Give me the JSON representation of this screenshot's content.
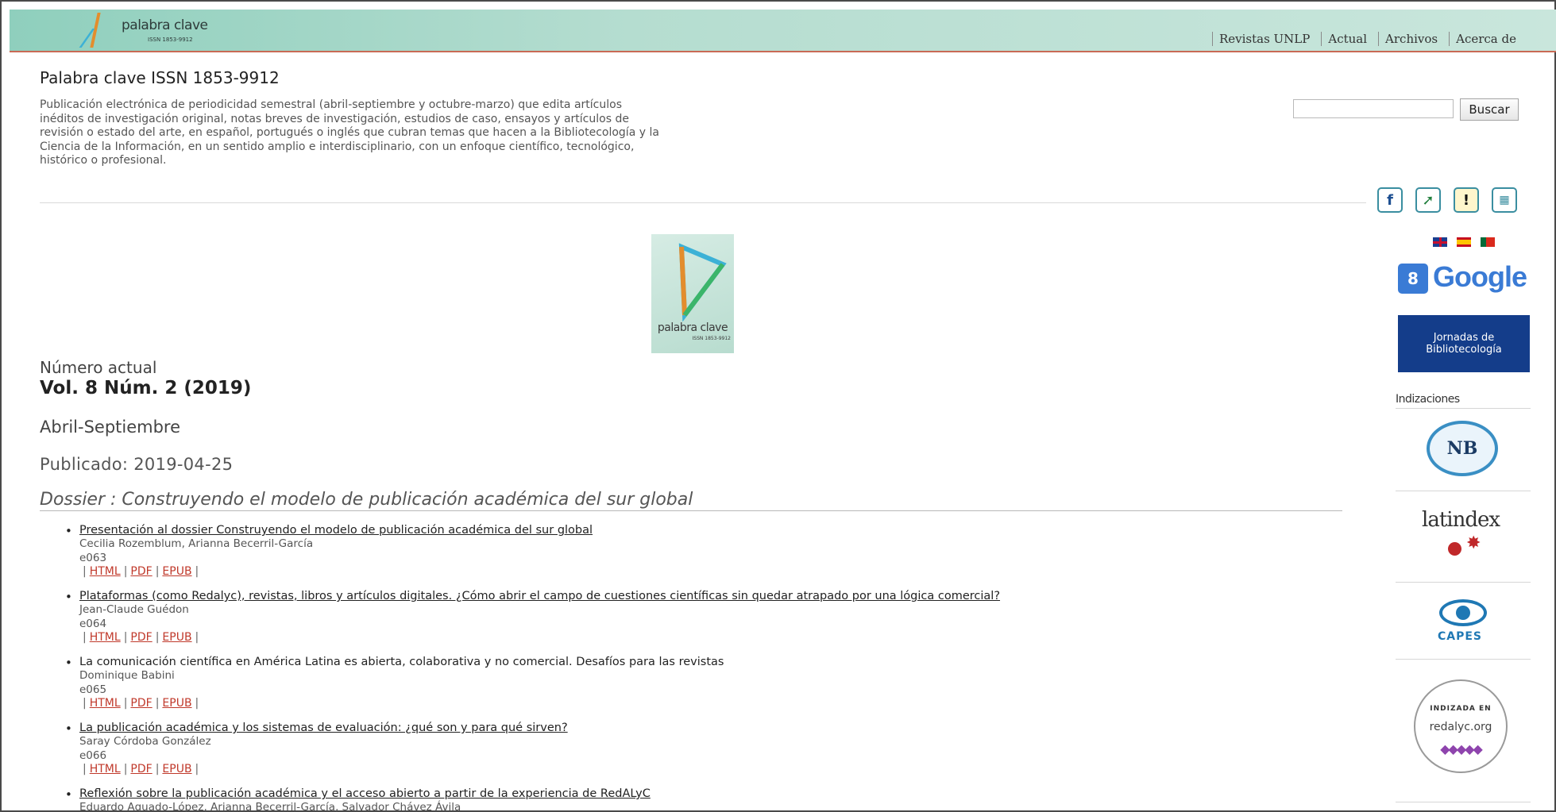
{
  "header": {
    "logo_text": "palabra clave",
    "logo_issn": "ISSN 1853-9912",
    "nav": [
      "Revistas UNLP",
      "Actual",
      "Archivos",
      "Acerca de"
    ]
  },
  "journal": {
    "title": "Palabra clave ISSN 1853-9912",
    "description": "Publicación electrónica de periodicidad semestral (abril-septiembre y octubre-marzo) que edita artículos inéditos de investigación original, notas breves de investigación, estudios de caso, ensayos y artículos de revisión o estado del arte, en español, portugués o inglés que cubran temas que hacen a la Bibliotecología y la Ciencia de la Información, en un sentido amplio e interdisciplinario, con un enfoque científico, tecnológico, histórico o profesional."
  },
  "search": {
    "value": "",
    "button_label": "Buscar"
  },
  "cover": {
    "text": "palabra clave",
    "issn": "ISSN 1853-9912"
  },
  "issue": {
    "label": "Número actual",
    "volume": "Vol. 8 Núm. 2 (2019)",
    "period": "Abril-Septiembre",
    "published": "Publicado: 2019-04-25",
    "section_title": "Dossier : Construyendo el modelo de publicación académica del sur global"
  },
  "articles": [
    {
      "title": "Presentación al dossier Construyendo el modelo de publicación académica del sur global",
      "authors": "Cecilia Rozemblum, Arianna Becerril-García",
      "code": "e063",
      "links": [
        "HTML",
        "PDF",
        "EPUB"
      ]
    },
    {
      "title": "Plataformas (como Redalyc), revistas, libros y artículos digitales. ¿Cómo abrir el campo de cuestiones científicas sin quedar atrapado por una lógica comercial?",
      "authors": "Jean-Claude Guédon",
      "code": "e064",
      "links": [
        "HTML",
        "PDF",
        "EPUB"
      ]
    },
    {
      "title": "La comunicación científica en América Latina es abierta, colaborativa y no comercial. Desafíos para las revistas",
      "authors": "Dominique Babini",
      "code": "e065",
      "links": [
        "HTML",
        "PDF",
        "EPUB"
      ]
    },
    {
      "title": "La publicación académica y los sistemas de evaluación: ¿qué son y para qué sirven?",
      "authors": "Saray Córdoba González",
      "code": "e066",
      "links": [
        "HTML",
        "PDF",
        "EPUB"
      ]
    },
    {
      "title": "Reflexión sobre la publicación académica y el acceso abierto a partir de la experiencia de RedALyC",
      "authors": "Eduardo Aguado-López, Arianna Becerril-García, Salvador Chávez Ávila",
      "code": "",
      "links": []
    }
  ],
  "sidebar": {
    "social_icons": [
      "facebook-icon",
      "share-icon",
      "alert-icon",
      "stats-icon"
    ],
    "flags": [
      "flag-en-icon",
      "flag-es-icon",
      "flag-pt-icon"
    ],
    "google_text": "Google",
    "jornadas_line1": "Jornadas de",
    "jornadas_line2": "Bibliotecología",
    "index_label": "Indizaciones",
    "nb_text": "NB",
    "latindex_text": "latindex",
    "capes_text": "CAPES",
    "redalyc_line1": "INDIZADA EN",
    "redalyc_line2": "redalyc.org"
  },
  "colors": {
    "header_bg": "#b5ddd0",
    "link_red": "#c0392b",
    "jornadas_bg": "#143d8a"
  }
}
